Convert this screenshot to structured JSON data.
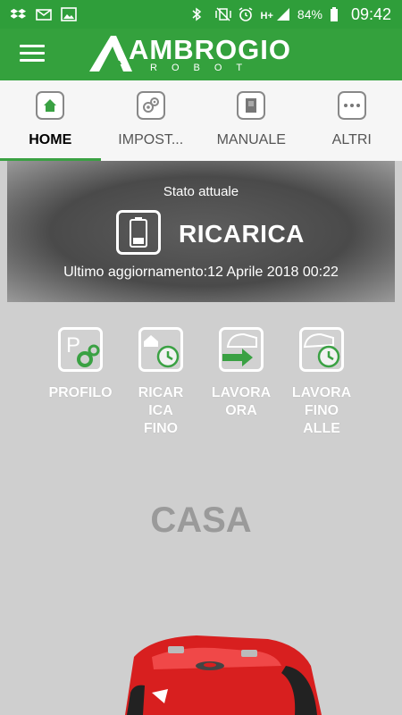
{
  "status_bar": {
    "battery": "84%",
    "time": "09:42",
    "network": "H+"
  },
  "app": {
    "logo_title": "AMBROGIO",
    "logo_subtitle": "ROBOT"
  },
  "tabs": [
    {
      "label": "HOME",
      "icon": "home-icon",
      "active": true
    },
    {
      "label": "IMPOST...",
      "icon": "settings-gears-icon",
      "active": false
    },
    {
      "label": "MANUALE",
      "icon": "manual-icon",
      "active": false
    },
    {
      "label": "ALTRI",
      "icon": "more-dots-icon",
      "active": false
    }
  ],
  "status": {
    "title": "Stato attuale",
    "value": "RICARICA",
    "updated": "Ultimo aggiornamento:12 Aprile 2018 00:22",
    "icon": "battery-icon"
  },
  "actions": [
    {
      "label_lines": [
        "PROFILO"
      ],
      "icon": "profile-gears-icon"
    },
    {
      "label_lines": [
        "RICAR",
        "ICA",
        "FINO"
      ],
      "icon": "charge-until-icon"
    },
    {
      "label_lines": [
        "LAVORA",
        "ORA"
      ],
      "icon": "work-now-icon"
    },
    {
      "label_lines": [
        "LAVORA",
        "FINO",
        "ALLE"
      ],
      "icon": "work-until-icon"
    }
  ],
  "zone_label": "CASA",
  "colors": {
    "brand_green": "#34a13d",
    "icon_green": "#3aa143",
    "robot_red": "#d81f1f"
  }
}
